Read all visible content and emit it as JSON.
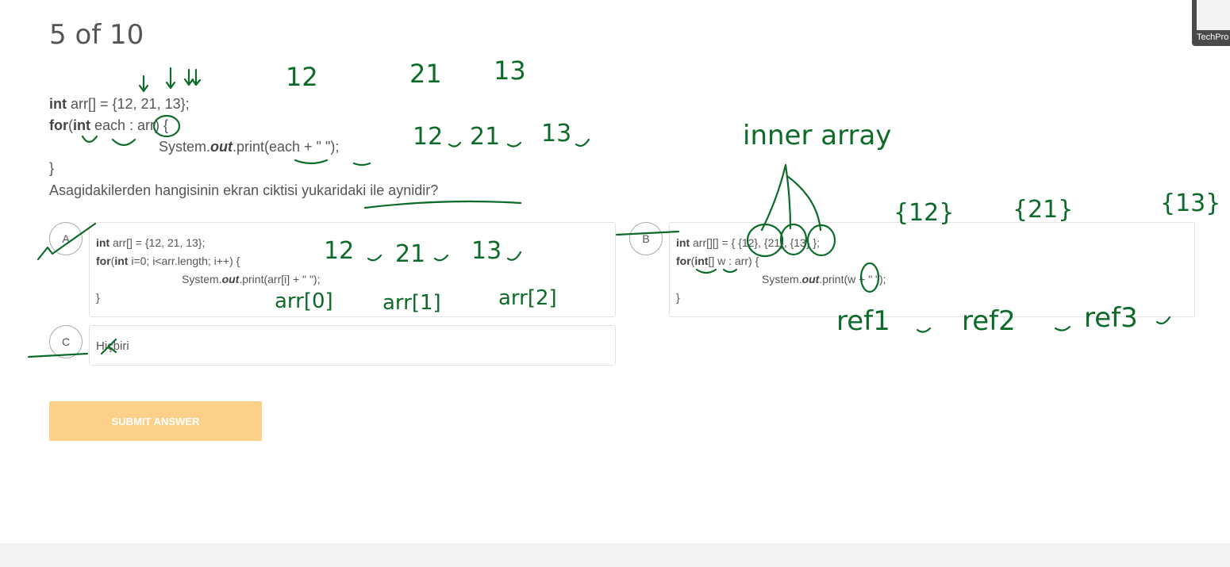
{
  "quiz": {
    "progress": "5 of 10",
    "question": {
      "code": {
        "line1_kw": "int",
        "line1_rest": " arr[] = {12, 21, 13};",
        "line2_kw_for": "for",
        "line2_paren": "(",
        "line2_kw_int": "int",
        "line2_rest": " each : arr) {",
        "line3": "System.",
        "line3_out": "out",
        "line3_rest": ".print(each + \" \");",
        "line4": "}"
      },
      "text": "Asagidakilerden hangisinin ekran ciktisi yukaridaki ile aynidir?"
    },
    "options": {
      "a": {
        "letter": "A",
        "kw_int": "int",
        "l1_rest": " arr[] = {12, 21, 13};",
        "kw_for": "for",
        "kw_int2": "int",
        "l2_open": "(",
        "l2_rest": " i=0; i<arr.length; i++) {",
        "l3": "System.",
        "l3_out": "out",
        "l3_rest": ".print(arr[i] + \" \");",
        "l4": "}"
      },
      "b": {
        "letter": "B",
        "kw_int": "int",
        "l1_rest": " arr[][] = { {12}, {21}, {13} };",
        "kw_for": "for",
        "kw_int2": "int",
        "l2_open": "(",
        "l2_rest": "[] w : arr) {",
        "l3": "System.",
        "l3_out": "out",
        "l3_rest": ".print(w + \" \");",
        "l4": "}"
      },
      "c": {
        "letter": "C",
        "text": "Hiçbiri"
      }
    },
    "submit_label": "SUBMIT ANSWER"
  },
  "video_thumb": {
    "label": "TechPro"
  },
  "annotations": {
    "color": "#0d6b2a",
    "top_numbers": [
      "12",
      "21",
      "13"
    ],
    "output_line": [
      "12",
      "21",
      "13"
    ],
    "option_a_output": [
      "12",
      "21",
      "13"
    ],
    "option_a_index": [
      "arr[0]",
      "arr[1]",
      "arr[2]"
    ],
    "inner_array": "inner array",
    "inner_values": [
      "{12}",
      "{21}",
      "{13}"
    ],
    "refs": [
      "ref1",
      "ref2",
      "ref3"
    ]
  }
}
